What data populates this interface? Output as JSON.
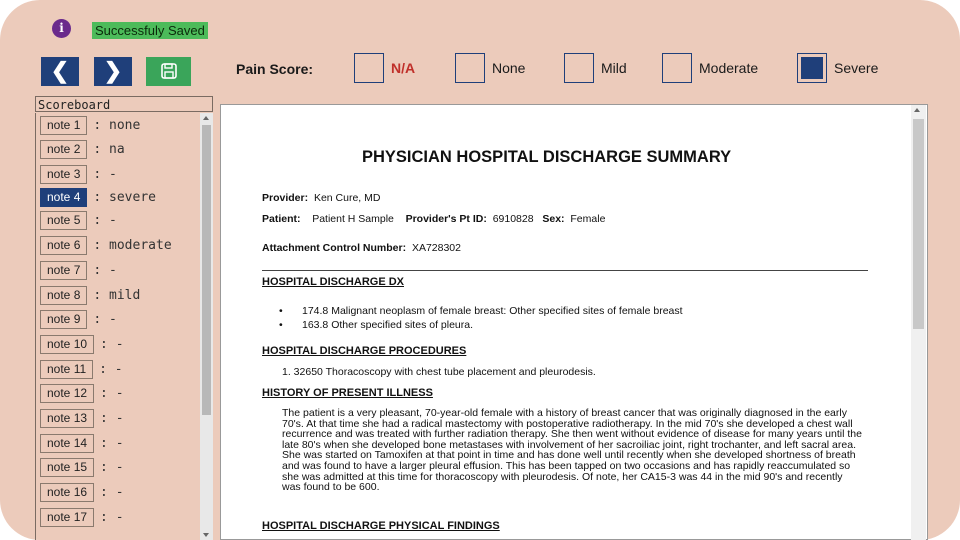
{
  "status": {
    "message": "Successfuly Saved",
    "info_icon": "i"
  },
  "toolbar": {
    "prev": "❮",
    "next": "❯",
    "save_icon": "floppy-disk-icon"
  },
  "pain_score": {
    "label": "Pain Score:",
    "options": [
      {
        "label": "N/A",
        "selected": false
      },
      {
        "label": "None",
        "selected": false
      },
      {
        "label": "Mild",
        "selected": false
      },
      {
        "label": "Moderate",
        "selected": false
      },
      {
        "label": "Severe",
        "selected": true
      }
    ]
  },
  "scoreboard": {
    "title": "Scoreboard",
    "notes": [
      {
        "label": "note 1",
        "value": ": none"
      },
      {
        "label": "note 2",
        "value": ": na"
      },
      {
        "label": "note 3",
        "value": ": -"
      },
      {
        "label": "note 4",
        "value": ": severe",
        "active": true
      },
      {
        "label": "note 5",
        "value": ": -"
      },
      {
        "label": "note 6",
        "value": ": moderate"
      },
      {
        "label": "note 7",
        "value": ": -"
      },
      {
        "label": "note 8",
        "value": ": mild"
      },
      {
        "label": "note 9",
        "value": ": -"
      },
      {
        "label": "note 10",
        "value": ": -"
      },
      {
        "label": "note 11",
        "value": ": -"
      },
      {
        "label": "note 12",
        "value": ": -"
      },
      {
        "label": "note 13",
        "value": ": -"
      },
      {
        "label": "note 14",
        "value": ": -"
      },
      {
        "label": "note 15",
        "value": ": -"
      },
      {
        "label": "note 16",
        "value": ": -"
      },
      {
        "label": "note 17",
        "value": ": -"
      }
    ]
  },
  "document": {
    "title": "PHYSICIAN HOSPITAL DISCHARGE SUMMARY",
    "provider_label": "Provider:",
    "provider": "Ken Cure, MD",
    "patient_label": "Patient:",
    "patient": "Patient H Sample",
    "pt_id_label": "Provider's Pt ID:",
    "pt_id": "6910828",
    "sex_label": "Sex:",
    "sex": "Female",
    "acn_label": "Attachment Control Number:",
    "acn": "XA728302",
    "dx_heading": "HOSPITAL DISCHARGE DX",
    "dx_items": [
      "174.8 Malignant neoplasm of female breast:  Other specified sites of female breast",
      "163.8 Other specified sites of pleura."
    ],
    "proc_heading": "HOSPITAL DISCHARGE PROCEDURES",
    "proc_item": "1. 32650 Thoracoscopy with chest tube placement and pleurodesis.",
    "hpi_heading": "HISTORY OF PRESENT ILLNESS",
    "hpi_text": "The patient is a very pleasant, 70-year-old female with a history of breast cancer that was originally diagnosed in the early 70's. At that time she had a radical mastectomy with postoperative radiotherapy. In the mid 70's she developed a chest wall recurrence and was treated with further radiation therapy. She then went without evidence of disease for many years until the late 80's when she developed bone metastases with involvement of her sacroiliac joint, right trochanter, and left sacral area. She was started on Tamoxifen at that point in time and has done well until recently when she developed shortness of breath and was found to have a larger pleural effusion. This has been tapped on two occasions and has rapidly reaccumulated so she was admitted at this time for thoracoscopy with pleurodesis. Of note, her CA15-3 was 44 in the mid 90's and recently was found to be 600.",
    "pf_heading": "HOSPITAL DISCHARGE PHYSICAL FINDINGS"
  }
}
